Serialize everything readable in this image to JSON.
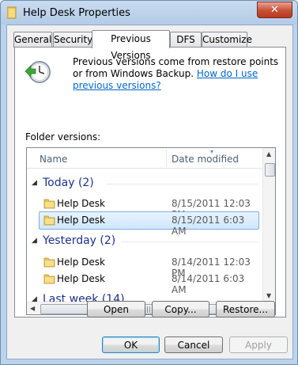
{
  "window": {
    "title": "Help Desk Properties",
    "close_glyph": "✕"
  },
  "tabs": [
    {
      "label": "General"
    },
    {
      "label": "Security"
    },
    {
      "label": "Previous Versions",
      "active": true
    },
    {
      "label": "DFS"
    },
    {
      "label": "Customize"
    }
  ],
  "description": {
    "text": "Previous versions come from restore points or from Windows Backup.",
    "link": "How do I use previous versions?"
  },
  "folder_versions_label": "Folder versions:",
  "columns": {
    "name": "Name",
    "date_modified": "Date modified"
  },
  "groups": [
    {
      "label": "Today (2)"
    },
    {
      "label": "Yesterday (2)"
    },
    {
      "label": "Last week (14)"
    }
  ],
  "items": [
    {
      "name": "Help Desk",
      "date": "8/15/2011 12:03 PM",
      "selected": false
    },
    {
      "name": "Help Desk",
      "date": "8/15/2011 6:03 AM",
      "selected": true
    },
    {
      "name": "Help Desk",
      "date": "8/14/2011 12:03 PM",
      "selected": false
    },
    {
      "name": "Help Desk",
      "date": "8/14/2011 6:03 AM",
      "selected": false
    }
  ],
  "actions": {
    "open": "Open",
    "copy": "Copy...",
    "restore": "Restore..."
  },
  "dialog_buttons": {
    "ok": "OK",
    "cancel": "Cancel",
    "apply": "Apply"
  },
  "icons": {
    "folder": "folder-icon",
    "restore_clock": "restore-clock-icon",
    "close": "close-icon"
  },
  "colors": {
    "group_header": "#1e3287",
    "link": "#0066cc",
    "selection": "#cfe7fd",
    "title_bar": "#bcd3ec",
    "close_button": "#c74f36"
  }
}
